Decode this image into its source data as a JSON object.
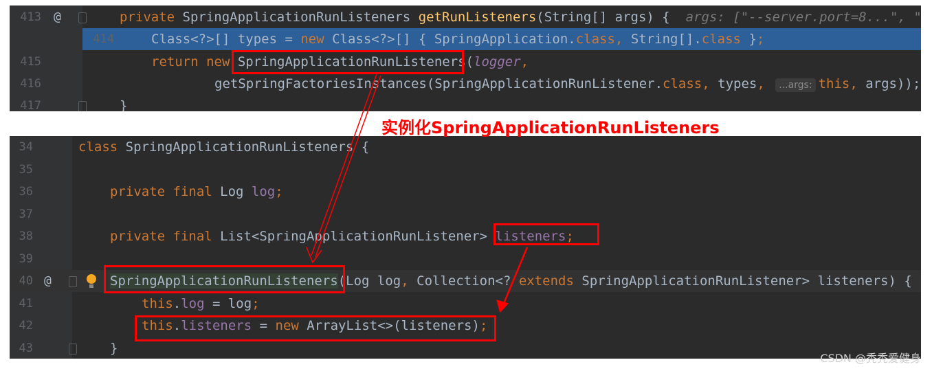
{
  "top_editor": {
    "lines": [
      {
        "num": "413",
        "at": true,
        "fold": true,
        "indent": 1,
        "tokens": [
          [
            "kw",
            "private "
          ],
          [
            "txt",
            "SpringApplicationRunListeners "
          ],
          [
            "fn",
            "getRunListeners"
          ],
          [
            "txt",
            "(String[] args) {  "
          ],
          [
            "hint",
            "args: [\"--server.port=8...\", \""
          ]
        ]
      },
      {
        "num": "414",
        "highlight": "blue",
        "indent": 2,
        "tokens": [
          [
            "txt",
            "Class<?>[] types = "
          ],
          [
            "kw",
            "new "
          ],
          [
            "txt",
            "Class<?>[] { SpringApplication."
          ],
          [
            "kw",
            "class"
          ],
          [
            "kw",
            ", "
          ],
          [
            "txt",
            "String[]."
          ],
          [
            "kw",
            "class "
          ],
          [
            "txt",
            "}"
          ],
          [
            "kw",
            ";"
          ]
        ]
      },
      {
        "num": "415",
        "indent": 2,
        "tokens": [
          [
            "kw",
            "return new "
          ],
          [
            "txt",
            "SpringApplicationRunListeners("
          ],
          [
            "fldi",
            "logger"
          ],
          [
            "kw",
            ","
          ]
        ]
      },
      {
        "num": "416",
        "indent": 4,
        "tokens": [
          [
            "txt",
            "getSpringFactoriesInstances(SpringApplicationRunListener."
          ],
          [
            "kw",
            "class"
          ],
          [
            "kw",
            ", "
          ],
          [
            "txt",
            "types"
          ],
          [
            "kw",
            ", "
          ],
          [
            "pill",
            "...args:"
          ],
          [
            "kw",
            "this"
          ],
          [
            "kw",
            ", "
          ],
          [
            "txt",
            "args));"
          ]
        ]
      },
      {
        "num": "417",
        "fold": true,
        "indent": 1,
        "tokens": [
          [
            "txt",
            "}"
          ]
        ]
      }
    ]
  },
  "bottom_editor": {
    "lines": [
      {
        "num": "34",
        "indent": 0,
        "tokens": [
          [
            "kw",
            "class "
          ],
          [
            "txt",
            "SpringApplicationRunListeners {"
          ]
        ]
      },
      {
        "num": "35",
        "indent": 0,
        "tokens": []
      },
      {
        "num": "36",
        "indent": 1,
        "tokens": [
          [
            "kw",
            "private final "
          ],
          [
            "txt",
            "Log "
          ],
          [
            "fld",
            "log"
          ],
          [
            "kw",
            ";"
          ]
        ]
      },
      {
        "num": "37",
        "indent": 0,
        "tokens": []
      },
      {
        "num": "38",
        "indent": 1,
        "tokens": [
          [
            "kw",
            "private final "
          ],
          [
            "txt",
            "List<SpringApplicationRunListener> "
          ],
          [
            "fld",
            "listeners"
          ],
          [
            "kw",
            ";"
          ]
        ]
      },
      {
        "num": "39",
        "indent": 0,
        "tokens": []
      },
      {
        "num": "40",
        "at": true,
        "fold": true,
        "bulb": true,
        "highlight": "row",
        "indent": 1,
        "tokens": [
          [
            "ctor",
            "SpringApplicationRunListeners"
          ],
          [
            "txt",
            "(Log log"
          ],
          [
            "kw",
            ", "
          ],
          [
            "txt",
            "Collection<? "
          ],
          [
            "kw",
            "extends "
          ],
          [
            "txt",
            "SpringApplicationRunListener> listeners) {"
          ]
        ]
      },
      {
        "num": "41",
        "indent": 2,
        "tokens": [
          [
            "kw",
            "this"
          ],
          [
            "txt",
            "."
          ],
          [
            "fld",
            "log"
          ],
          [
            "txt",
            " = log"
          ],
          [
            "kw",
            ";"
          ]
        ]
      },
      {
        "num": "42",
        "indent": 2,
        "tokens": [
          [
            "kw",
            "this"
          ],
          [
            "txt",
            "."
          ],
          [
            "fld",
            "listeners"
          ],
          [
            "txt",
            " = "
          ],
          [
            "kw",
            "new "
          ],
          [
            "txt",
            "ArrayList<>(listeners)"
          ],
          [
            "kw",
            ";"
          ]
        ]
      },
      {
        "num": "43",
        "fold": true,
        "indent": 1,
        "tokens": [
          [
            "txt",
            "}"
          ]
        ]
      }
    ]
  },
  "annotation": {
    "label": "实例化SpringApplicationRunListeners",
    "color": "#ff0000"
  },
  "watermark": "CSDN @秃秃爱健身",
  "colors": {
    "background": "#2b2b2b",
    "keyword": "#cc7832",
    "text": "#a9b7c6",
    "method": "#ffc66d",
    "field": "#9876aa",
    "selection": "#2d5f99"
  }
}
